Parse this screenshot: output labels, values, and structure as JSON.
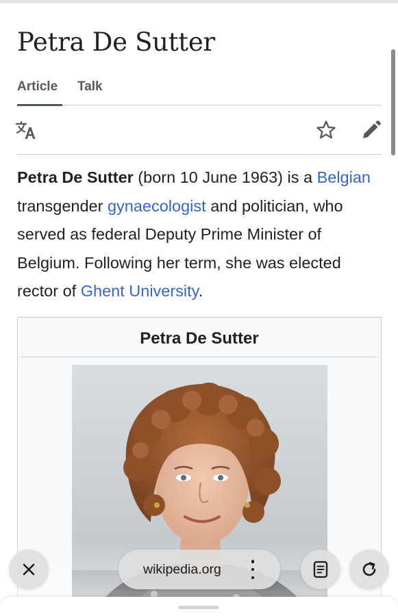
{
  "article": {
    "title": "Petra De Sutter"
  },
  "tabs": [
    {
      "label": "Article",
      "active": true
    },
    {
      "label": "Talk",
      "active": false
    }
  ],
  "toolbar": {
    "icons": [
      "language-icon",
      "star-icon",
      "edit-pencil-icon"
    ]
  },
  "intro": {
    "subject": "Petra De Sutter",
    "text_1": " (born 10 June 1963) is a ",
    "link_1": "Belgian",
    "text_2": " transgender ",
    "link_2": "gynaecologist",
    "text_3": " and politician, who served as federal Deputy Prime Minister of Belgium. Following her term, she was elected rector of ",
    "link_3": "Ghent University",
    "text_4": "."
  },
  "infobox": {
    "title": "Petra De Sutter"
  },
  "browser": {
    "url": "wikipedia.org",
    "buttons": [
      "close-icon",
      "more-vertical-icon",
      "reader-mode-icon",
      "reload-icon"
    ]
  },
  "colors": {
    "link": "#3366cc",
    "text": "#202122",
    "tab_text": "#54595d",
    "divider": "#c8ccd1",
    "infobox_bg": "#f8f9fa",
    "pill_bg": "#dedede"
  }
}
